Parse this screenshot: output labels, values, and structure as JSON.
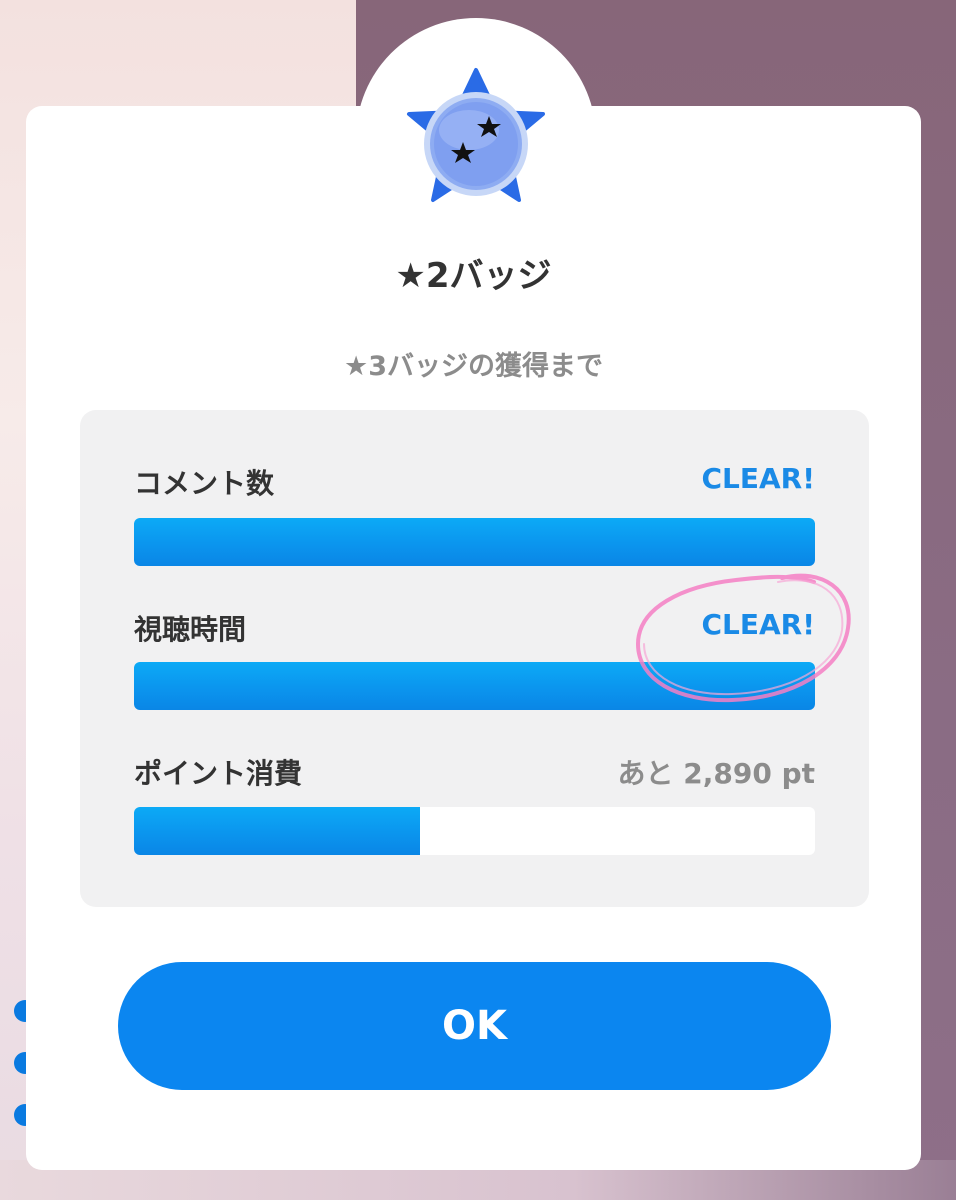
{
  "badge": {
    "icon": "star-badge-icon",
    "title": "★2バッジ"
  },
  "subtitle": "★3バッジの獲得まで",
  "requirements": [
    {
      "label": "コメント数",
      "status": "CLEAR!",
      "progress": 1.0
    },
    {
      "label": "視聴時間",
      "status": "CLEAR!",
      "progress": 1.0
    },
    {
      "label": "ポイント消費",
      "status": "あと 2,890 pt",
      "progress": 0.42
    }
  ],
  "ok_label": "OK",
  "colors": {
    "accent": "#0b86f0",
    "clear_text": "#1a8ae6",
    "annotation": "#f47fc4"
  }
}
